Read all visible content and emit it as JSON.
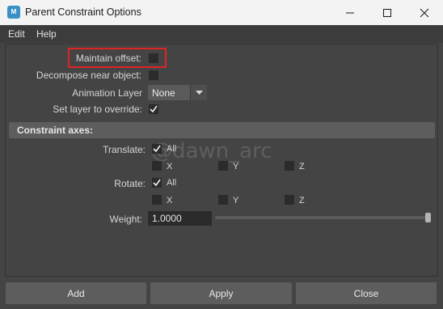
{
  "window": {
    "title": "Parent Constraint Options",
    "app_icon_letter": "M",
    "accent_color": "#3a8fc4"
  },
  "menu": {
    "edit": "Edit",
    "help": "Help"
  },
  "options": {
    "maintain_offset_label": "Maintain offset:",
    "maintain_offset_checked": false,
    "decompose_label": "Decompose near object:",
    "decompose_checked": false,
    "animation_layer_label": "Animation Layer",
    "animation_layer_value": "None",
    "set_layer_label": "Set layer to override:",
    "set_layer_checked": true
  },
  "constraint_axes": {
    "header": "Constraint axes:",
    "translate_label": "Translate:",
    "translate_all": "All",
    "translate_all_checked": true,
    "translate_x": "X",
    "translate_y": "Y",
    "translate_z": "Z",
    "rotate_label": "Rotate:",
    "rotate_all": "All",
    "rotate_all_checked": true,
    "rotate_x": "X",
    "rotate_y": "Y",
    "rotate_z": "Z"
  },
  "weight": {
    "label": "Weight:",
    "value": "1.0000",
    "slider_fraction": 1.0
  },
  "watermark": "@dawn_arc",
  "buttons": {
    "add": "Add",
    "apply": "Apply",
    "close": "Close"
  },
  "highlight_color": "#e02424"
}
